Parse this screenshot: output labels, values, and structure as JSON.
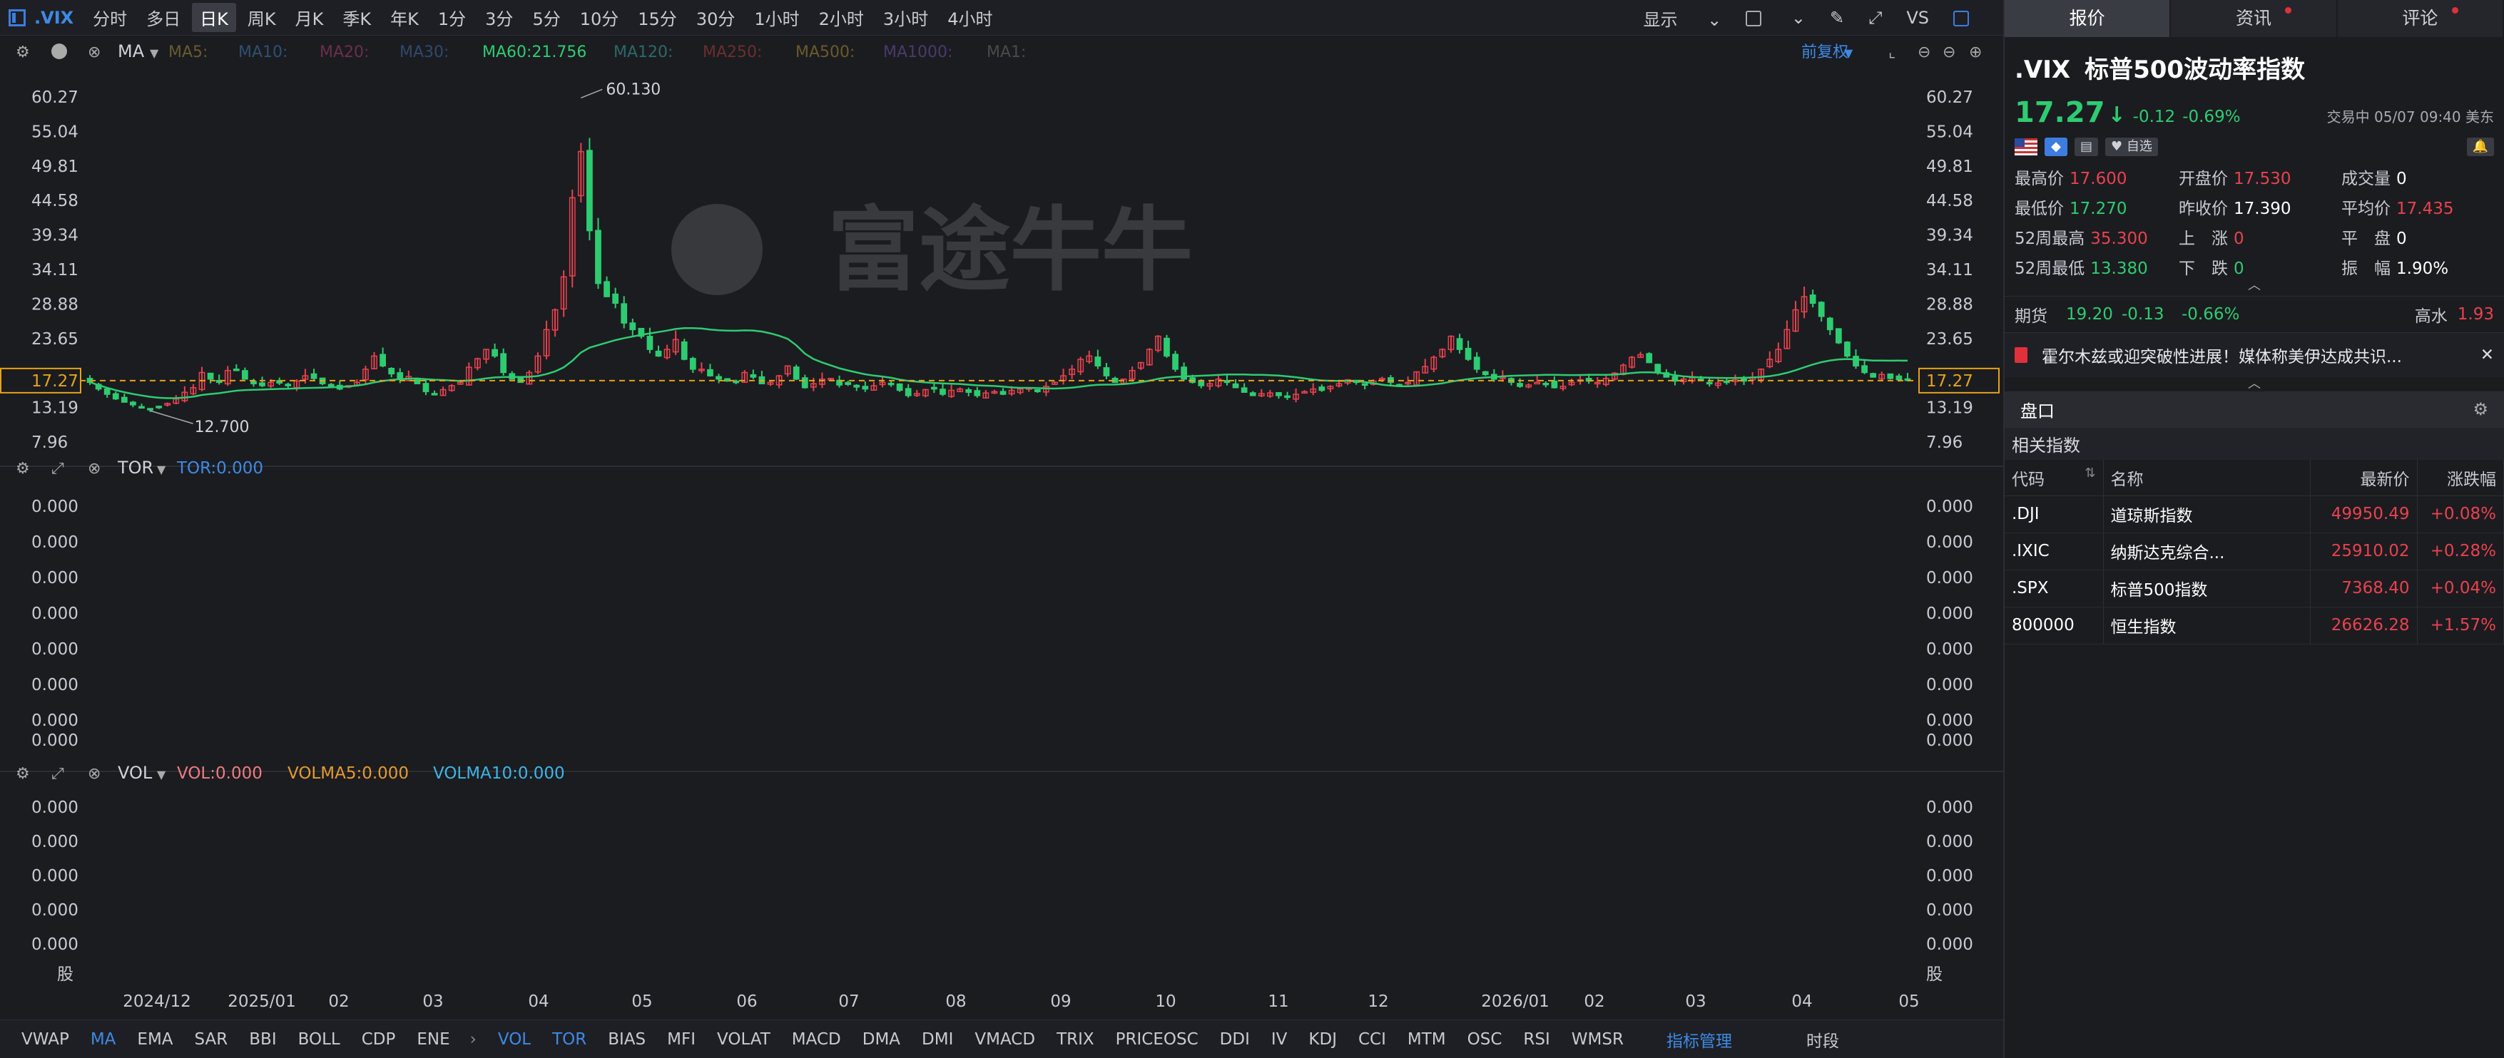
{
  "topbar": {
    "symbol": ".VIX",
    "timeframes": [
      "分时",
      "多日",
      "日K",
      "周K",
      "月K",
      "季K",
      "年K",
      "1分",
      "3分",
      "5分",
      "10分",
      "15分",
      "30分",
      "1小时",
      "2小时",
      "3小时",
      "4小时"
    ],
    "active_timeframe": "日K",
    "display_label": "显示",
    "vs_label": "VS"
  },
  "ma_bar": {
    "label": "MA",
    "items": [
      {
        "text": "MA5:",
        "color": "#6b5a2a"
      },
      {
        "text": "MA10:",
        "color": "#2f4f73"
      },
      {
        "text": "MA20:",
        "color": "#6b2f4a"
      },
      {
        "text": "MA30:",
        "color": "#2f4a6b"
      },
      {
        "text": "MA60:21.756",
        "color": "#2ecc71"
      },
      {
        "text": "MA120:",
        "color": "#2a6a6a"
      },
      {
        "text": "MA250:",
        "color": "#6b2f2f"
      },
      {
        "text": "MA500:",
        "color": "#6b5a2a"
      },
      {
        "text": "MA1000:",
        "color": "#4a3a6b"
      },
      {
        "text": "MA1:",
        "color": "#4a4a4a"
      }
    ],
    "adjust_label": "前复权"
  },
  "tor_bar": {
    "label": "TOR",
    "value": "TOR:0.000"
  },
  "vol_bar": {
    "label": "VOL",
    "vol": "VOL:0.000",
    "volma5": "VOLMA5:0.000",
    "volma10": "VOLMA10:0.000"
  },
  "watermark": "富途牛牛",
  "chart_data": {
    "type": "candlestick",
    "price_axis_ticks": [
      "60.27",
      "55.04",
      "49.81",
      "44.58",
      "39.34",
      "34.11",
      "28.88",
      "23.65",
      "18.42",
      "13.19",
      "7.96"
    ],
    "ylim": [
      7.96,
      60.27
    ],
    "current_price": "17.27",
    "high_annotation": "60.130",
    "low_annotation": "12.700",
    "ma60_current": 21.756,
    "x_tick_labels": [
      "2024/12",
      "2025/01",
      "02",
      "03",
      "04",
      "05",
      "06",
      "07",
      "08",
      "09",
      "10",
      "11",
      "12",
      "2026/01",
      "02",
      "03",
      "04",
      "05"
    ],
    "tor_axis_ticks": [
      "0.000",
      "0.000",
      "0.000",
      "0.000",
      "0.000",
      "0.000",
      "0.000",
      "0.000"
    ],
    "vol_axis_ticks": [
      "0.000",
      "0.000",
      "0.000",
      "0.000",
      "0.000",
      "股"
    ],
    "close_series": [
      17.0,
      16.0,
      15.2,
      14.5,
      14.0,
      13.6,
      13.3,
      13.0,
      13.2,
      13.8,
      14.5,
      15.5,
      16.2,
      18.5,
      17.5,
      17.0,
      18.8,
      19.0,
      17.5,
      16.8,
      16.5,
      17.0,
      16.9,
      16.5,
      17.2,
      18.0,
      17.6,
      16.8,
      16.4,
      16.0,
      16.5,
      17.0,
      19.0,
      21.0,
      19.5,
      18.3,
      17.5,
      17.9,
      16.8,
      15.6,
      15.2,
      15.9,
      16.5,
      17.0,
      19.3,
      20.6,
      22.0,
      21.0,
      18.5,
      17.5,
      17.0,
      18.5,
      21.0,
      25.0,
      28.0,
      33.0,
      45.0,
      52.0,
      40.0,
      32.0,
      30.0,
      29.0,
      26.0,
      25.0,
      24.0,
      22.0,
      21.0,
      22.0,
      23.5,
      20.5,
      19.0,
      19.0,
      18.0,
      17.5,
      17.2,
      17.0,
      18.5,
      17.8,
      16.8,
      17.0,
      18.0,
      19.5,
      17.5,
      16.2,
      16.8,
      17.5,
      17.6,
      16.6,
      16.7,
      16.3,
      16.0,
      16.5,
      17.0,
      16.7,
      15.8,
      15.0,
      15.3,
      15.9,
      16.0,
      15.2,
      15.8,
      16.0,
      15.5,
      15.0,
      15.4,
      15.6,
      15.2,
      15.8,
      16.0,
      16.2,
      15.6,
      16.4,
      17.0,
      18.0,
      19.0,
      20.5,
      21.0,
      19.5,
      18.0,
      17.0,
      17.5,
      18.8,
      20.0,
      22.0,
      24.0,
      21.0,
      19.0,
      17.5,
      17.0,
      16.5,
      16.8,
      17.5,
      17.0,
      16.2,
      15.5,
      15.0,
      15.3,
      15.4,
      15.0,
      14.8,
      15.2,
      15.6,
      16.0,
      15.8,
      16.4,
      16.8,
      17.4,
      17.0,
      16.6,
      17.2,
      17.6,
      17.0,
      16.6,
      17.0,
      18.6,
      19.4,
      20.8,
      22.0,
      24.0,
      22.0,
      20.5,
      19.0,
      18.2,
      17.5,
      17.8,
      17.0,
      16.4,
      16.6,
      17.0,
      16.8,
      16.2,
      16.4,
      17.0,
      17.4,
      17.2,
      17.0,
      17.6,
      18.4,
      19.6,
      20.8,
      21.2,
      20.0,
      18.6,
      17.8,
      17.2,
      17.5,
      17.7,
      17.3,
      16.8,
      16.9,
      17.1,
      17.4,
      17.2,
      17.8,
      19.0,
      20.5,
      22.0,
      25.0,
      28.0,
      30.0,
      29.0,
      27.0,
      25.0,
      23.0,
      21.0,
      19.5,
      18.5,
      17.8,
      18.2,
      17.6,
      17.4,
      17.3
    ]
  },
  "panel": {
    "tabs": [
      {
        "label": "报价",
        "dot": false
      },
      {
        "label": "资讯",
        "dot": true
      },
      {
        "label": "评论",
        "dot": true
      }
    ],
    "symbol": ".VIX",
    "name": "标普500波动率指数",
    "price": "17.27",
    "change": "-0.12",
    "change_pct": "-0.69%",
    "status": "交易中 05/07 09:40 美东",
    "watch_label": "自选",
    "stats": [
      [
        {
          "label": "最高价",
          "value": "17.600",
          "color": "red"
        },
        {
          "label": "开盘价",
          "value": "17.530",
          "color": "red"
        },
        {
          "label": "成交量",
          "value": "0",
          "color": "white"
        }
      ],
      [
        {
          "label": "最低价",
          "value": "17.270",
          "color": "green"
        },
        {
          "label": "昨收价",
          "value": "17.390",
          "color": "white"
        },
        {
          "label": "平均价",
          "value": "17.435",
          "color": "red"
        }
      ],
      [
        {
          "label": "52周最高",
          "value": "35.300",
          "color": "red"
        },
        {
          "label": "上　涨",
          "value": "0",
          "color": "red"
        },
        {
          "label": "平　盘",
          "value": "0",
          "color": "white"
        }
      ],
      [
        {
          "label": "52周最低",
          "value": "13.380",
          "color": "green"
        },
        {
          "label": "下　跌",
          "value": "0",
          "color": "green"
        },
        {
          "label": "振　幅",
          "value": "1.90%",
          "color": "white"
        }
      ]
    ],
    "futures": {
      "label": "期货",
      "price": "19.20",
      "change": "-0.13",
      "pct": "-0.66%",
      "right_label": "高水",
      "right_value": "1.93"
    },
    "news": "霍尔木兹或迎突破性进展！媒体称美伊达成共识...",
    "section": "盘口",
    "related_title": "相关指数",
    "table_headers": [
      "代码",
      "名称",
      "最新价",
      "涨跌幅"
    ],
    "related": [
      {
        "code": ".DJI",
        "name": "道琼斯指数",
        "price": "49950.49",
        "pct": "+0.08%"
      },
      {
        "code": ".IXIC",
        "name": "纳斯达克综合...",
        "price": "25910.02",
        "pct": "+0.28%"
      },
      {
        "code": ".SPX",
        "name": "标普500指数",
        "price": "7368.40",
        "pct": "+0.04%"
      },
      {
        "code": "800000",
        "name": "恒生指数",
        "price": "26626.28",
        "pct": "+1.57%"
      }
    ]
  },
  "indicator_bar": {
    "left": [
      "VWAP",
      "MA",
      "EMA",
      "SAR",
      "BBI",
      "BOLL",
      "CDP",
      "ENE"
    ],
    "left_active": "MA",
    "right": [
      "VOL",
      "TOR",
      "BIAS",
      "MFI",
      "VOLAT",
      "MACD",
      "DMA",
      "DMI",
      "VMACD",
      "TRIX",
      "PRICEOSC",
      "DDI",
      "IV",
      "KDJ",
      "CCI",
      "MTM",
      "OSC",
      "RSI",
      "WMSR"
    ],
    "right_active": [
      "VOL",
      "TOR"
    ],
    "manage_label": "指标管理",
    "time_label": "时段"
  },
  "colors": {
    "up": "#e8424e",
    "down": "#2ecc71",
    "accent": "#3d8ae6",
    "price_box": "#e6a317",
    "ma60": "#2ecc71"
  }
}
